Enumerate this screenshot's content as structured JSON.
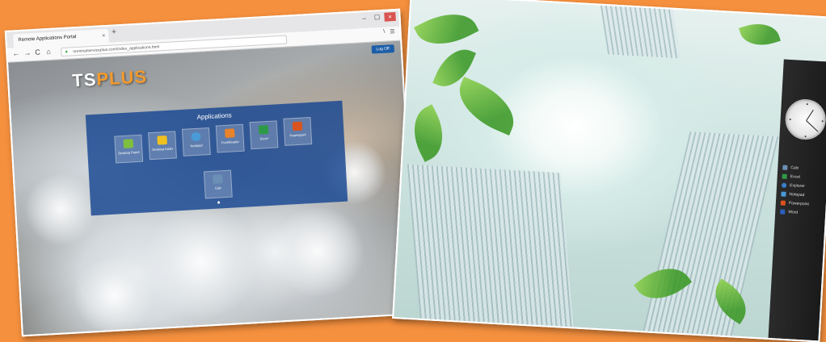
{
  "browser": {
    "tab_title": "Remote Applications Portal",
    "tab_close": "×",
    "new_tab": "+",
    "url": "terminalserviceplus.com/index_applications.html",
    "window_controls": [
      "–",
      "☐",
      "×"
    ],
    "nav": {
      "back": "←",
      "forward": "→",
      "reload": "C",
      "home": "⌂"
    },
    "nav_right": [
      "\\",
      "☰"
    ]
  },
  "portal": {
    "logout_label": "Log Off",
    "logo_main": "TS",
    "logo_plus": "PLUS",
    "panel_title": "Applications",
    "apps": [
      {
        "label": "Desktop Panel",
        "color": "#7fbf3f"
      },
      {
        "label": "Desktop folder",
        "color": "#f0c020"
      },
      {
        "label": "Notepad",
        "color": "#4a9ad8"
      },
      {
        "label": "FoxitReader",
        "color": "#e8832a"
      },
      {
        "label": "Excel",
        "color": "#2e9a48"
      },
      {
        "label": "Powerpoint",
        "color": "#d9531e"
      },
      {
        "label": "Calc",
        "color": "#6b8fb5"
      }
    ]
  },
  "desktop": {
    "apps": [
      {
        "label": "Calc",
        "color": "#6b8fb5"
      },
      {
        "label": "Excel",
        "color": "#2e9a48"
      },
      {
        "label": "Explorer",
        "color": "#3a7fd0"
      },
      {
        "label": "Notepad",
        "color": "#4a9ad8"
      },
      {
        "label": "Powerpoint",
        "color": "#d9531e"
      },
      {
        "label": "Word",
        "color": "#2b5fb8"
      }
    ]
  },
  "colors": {
    "background": "#f5903e",
    "panel_blue": "#164691",
    "accent_orange": "#f39a2d"
  }
}
